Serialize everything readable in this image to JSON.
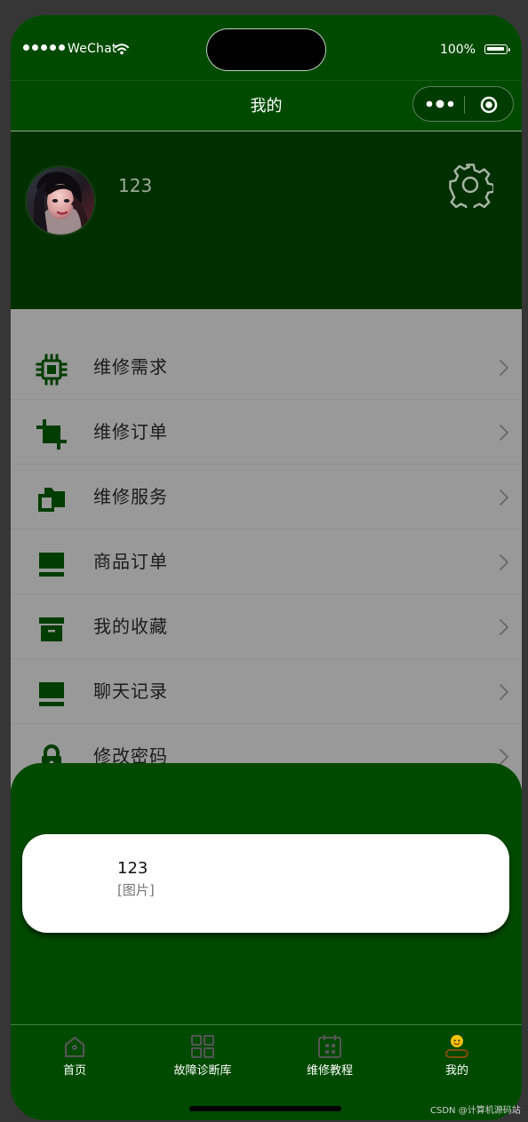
{
  "status_bar": {
    "carrier": "WeChat",
    "battery": "100%"
  },
  "navigation": {
    "title": "我的"
  },
  "profile": {
    "username": "123",
    "settings_icon": "gear-icon"
  },
  "menu": {
    "items": [
      {
        "label": "维修需求",
        "icon": "chip-icon"
      },
      {
        "label": "维修订单",
        "icon": "crop-icon"
      },
      {
        "label": "维修服务",
        "icon": "folders-icon"
      },
      {
        "label": "商品订单",
        "icon": "split-box-icon"
      },
      {
        "label": "我的收藏",
        "icon": "archive-icon"
      },
      {
        "label": "聊天记录",
        "icon": "split-box-icon"
      },
      {
        "label": "修改密码",
        "icon": "lock-icon"
      }
    ]
  },
  "popup": {
    "title": "123",
    "subtitle": "[图片]"
  },
  "tabs": {
    "items": [
      {
        "label": "首页",
        "icon": "home-icon",
        "active": false
      },
      {
        "label": "故障诊断库",
        "icon": "grid-icon",
        "active": false
      },
      {
        "label": "维修教程",
        "icon": "calendar-icon",
        "active": false
      },
      {
        "label": "我的",
        "icon": "profile-emoji-icon",
        "active": true
      }
    ]
  },
  "watermark": "CSDN @计算机源码站",
  "colors": {
    "primary_green": "#004a00",
    "profile_green": "#002f00",
    "menu_gray": "#999999",
    "active_tab": "#f4c20d"
  }
}
